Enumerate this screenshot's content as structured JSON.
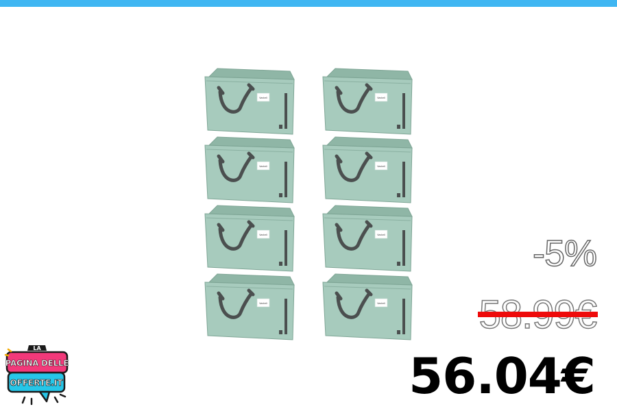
{
  "product": {
    "image_alt": "8 borse portaoggetti verde salvia",
    "bag_count": 8,
    "bag_label": "Vasteli",
    "bag_color": "#a7cbbd",
    "bag_color_dark": "#8fb6a6",
    "handle_color": "#4b4f4f"
  },
  "pricing": {
    "discount": "-5%",
    "old_price": "58.99€",
    "new_price": "56.04€",
    "strike_color": "#ee0a0a"
  },
  "brand": {
    "logo_line1": "LA",
    "logo_line2": "PAGINA DELLE",
    "logo_line3": "OFFERTE.IT"
  },
  "colors": {
    "top_bar": "#3fb6f2",
    "background": "#ffffff"
  }
}
